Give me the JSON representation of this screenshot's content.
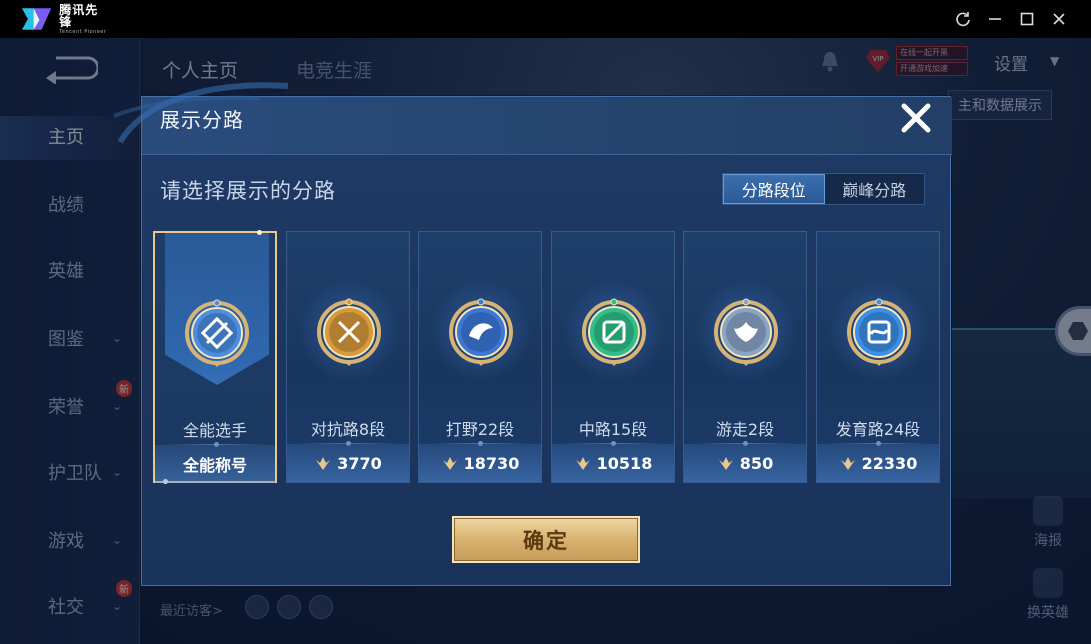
{
  "titlebar": {
    "app_name": "腾讯先锋",
    "app_name_en": "Tencent Pioneer",
    "controls": [
      "refresh-icon",
      "minimize-icon",
      "maximize-icon",
      "close-icon"
    ]
  },
  "background": {
    "top_tabs": [
      "个人主页",
      "电竞生涯"
    ],
    "settings_label": "设置",
    "data_button_label": "主和数据展示",
    "vip_lines": [
      "在线一起开黑",
      "开通游戏加速"
    ],
    "vip_badge": "VIP",
    "nav": [
      {
        "label": "主页",
        "active": true,
        "chevron": false,
        "new": false
      },
      {
        "label": "战绩",
        "active": false,
        "chevron": false,
        "new": false
      },
      {
        "label": "英雄",
        "active": false,
        "chevron": false,
        "new": false
      },
      {
        "label": "图鉴",
        "active": false,
        "chevron": true,
        "new": false
      },
      {
        "label": "荣誉",
        "active": false,
        "chevron": true,
        "new": true
      },
      {
        "label": "护卫队",
        "active": false,
        "chevron": true,
        "new": false
      },
      {
        "label": "游戏",
        "active": false,
        "chevron": true,
        "new": false
      },
      {
        "label": "社交",
        "active": false,
        "chevron": true,
        "new": true
      }
    ],
    "new_badge": "新",
    "recent_visitors_label": "最近访客>",
    "side_buttons": [
      "海报",
      "换英雄"
    ]
  },
  "modal": {
    "title": "展示分路",
    "subtitle": "请选择展示的分路",
    "segments": [
      {
        "label": "分路段位",
        "active": true
      },
      {
        "label": "巅峰分路",
        "active": false
      }
    ],
    "cards": [
      {
        "label": "全能选手",
        "value": "全能称号",
        "selected": true,
        "emblem": "all-round-emblem-icon",
        "accent": "#4b8ee0"
      },
      {
        "label": "对抗路8段",
        "value": "3770",
        "selected": false,
        "emblem": "clash-lane-emblem-icon",
        "accent": "#d89a3c"
      },
      {
        "label": "打野22段",
        "value": "18730",
        "selected": false,
        "emblem": "jungle-emblem-icon",
        "accent": "#3c78d8"
      },
      {
        "label": "中路15段",
        "value": "10518",
        "selected": false,
        "emblem": "mid-lane-emblem-icon",
        "accent": "#2fbf8a"
      },
      {
        "label": "游走2段",
        "value": "850",
        "selected": false,
        "emblem": "roam-emblem-icon",
        "accent": "#8aa4c6"
      },
      {
        "label": "发育路24段",
        "value": "22330",
        "selected": false,
        "emblem": "farm-lane-emblem-icon",
        "accent": "#3b8fe6"
      }
    ],
    "confirm_label": "确定"
  }
}
